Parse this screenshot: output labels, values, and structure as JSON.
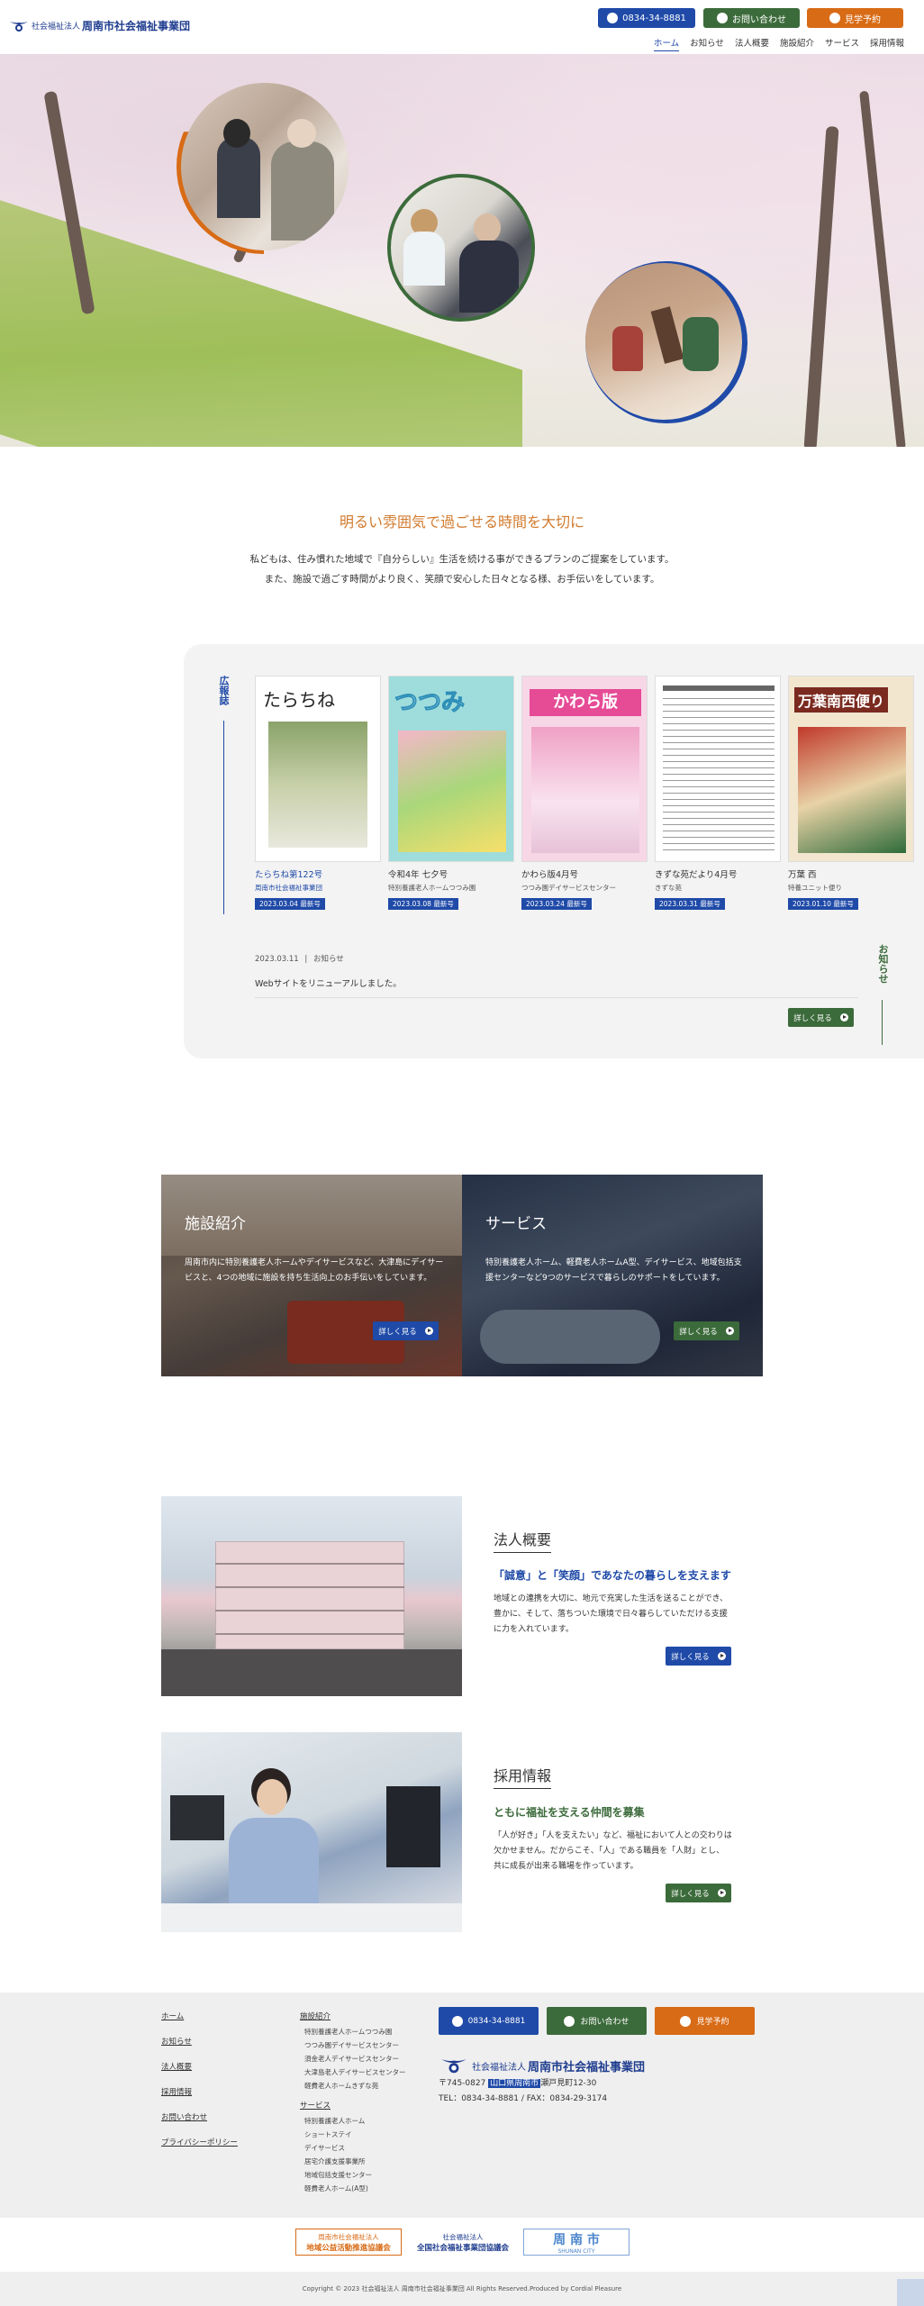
{
  "header": {
    "logo_small": "社会福祉法人",
    "logo_big": "周南市社会福祉事業団",
    "tel_label": "0834-34-8881",
    "contact_label": "お問い合わせ",
    "visit_label": "見学予約",
    "nav": [
      "ホーム",
      "お知らせ",
      "法人概要",
      "施設紹介",
      "サービス",
      "採用情報"
    ]
  },
  "intro": {
    "title": "明るい雰囲気で過ごせる時間を大切に",
    "line1": "私どもは、住み慣れた地域で『自分らしい』生活を続ける事ができるプランのご提案をしています。",
    "line2": "また、施設で過ごす時間がより良く、笑顔で安心した日々となる様、お手伝いをしています。"
  },
  "kouho": {
    "label": "広報誌",
    "items": [
      {
        "title": "たらちね第122号",
        "sub": "周南市社会福祉事業団",
        "date": "2023.03.04 最新号",
        "cover_title": "たらちね"
      },
      {
        "title": "令和4年 七夕号",
        "sub": "特別養護老人ホームつつみ園",
        "date": "2023.03.08 最新号",
        "cover_title": "つつみ"
      },
      {
        "title": "かわら版4月号",
        "sub": "つつみ園デイサービスセンター",
        "date": "2023.03.24 最新号",
        "cover_title": "かわら版"
      },
      {
        "title": "きずな苑だより4月号",
        "sub": "きずな苑",
        "date": "2023.03.31 最新号",
        "cover_title": ""
      },
      {
        "title": "万葉 西",
        "sub": "特養ユニット便り",
        "date": "2023.01.10 最新号",
        "cover_title": "万葉南西便り"
      }
    ]
  },
  "news": {
    "label": "お知らせ",
    "date": "2023.03.11",
    "category": "お知らせ",
    "title": "Webサイトをリニューアルしました。",
    "more_label": "詳しく見る"
  },
  "tiles": [
    {
      "title": "施設紹介",
      "text": "周南市内に特別養護老人ホームやデイサービスなど、大津島にデイサービスと、4つの地域に施設を持ち生活向上のお手伝いをしています。",
      "more_label": "詳しく見る"
    },
    {
      "title": "サービス",
      "text": "特別養護老人ホーム、軽費老人ホームA型、デイサービス、地域包括支援センターなど9つのサービスで暮らしのサポートをしています。",
      "more_label": "詳しく見る"
    }
  ],
  "about": {
    "title": "法人概要",
    "sub": "「誠意」と「笑顔」であなたの暮らしを支えます",
    "text": "地域との連携を大切に、地元で充実した生活を送ることができ、豊かに、そして、落ちついた環境で日々暮らしていただける支援に力を入れています。",
    "more_label": "詳しく見る"
  },
  "recruit": {
    "title": "採用情報",
    "sub": "ともに福祉を支える仲間を募集",
    "text": "「人が好き」「人を支えたい」など、福祉において人との交わりは欠かせません。だからこそ、「人」である職員を「人財」とし、共に成長が出来る職場を作っています。",
    "more_label": "詳しく見る"
  },
  "footer": {
    "col1": [
      "ホーム",
      "お知らせ",
      "法人概要",
      "採用情報",
      "お問い合わせ",
      "プライバシーポリシー"
    ],
    "facility_head": "施設紹介",
    "facilities": [
      "特別養護老人ホームつつみ園",
      "つつみ園デイサービスセンター",
      "須金老人デイサービスセンター",
      "大津島老人デイサービスセンター",
      "軽費老人ホームきずな苑"
    ],
    "service_head": "サービス",
    "services": [
      "特別養護老人ホーム",
      "ショートステイ",
      "デイサービス",
      "居宅介護支援事業所",
      "地域包括支援センター",
      "軽費老人ホーム(A型)"
    ],
    "tel_label": "0834-34-8881",
    "contact_label": "お問い合わせ",
    "visit_label": "見学予約",
    "logo_small": "社会福祉法人",
    "logo_big": "周南市社会福祉事業団",
    "address_pre": "〒745-0827 ",
    "address_highlight": "山口県周南市",
    "address_post": "瀬戸見町12-30",
    "phone_fax": "TEL：0834-34-8881 / FAX：0834-29-3174"
  },
  "banners": [
    {
      "line1": "周南市社会福祉法人",
      "line2": "地域公益活動推進協議会"
    },
    {
      "line1": "社会福祉法人",
      "line2": "全国社会福祉事業団協議会"
    },
    {
      "line1": "周 南 市",
      "line2": "SHUNAN CITY"
    }
  ],
  "copyright": "Copyright © 2023 社会福祉法人 周南市社会福祉事業団 All Rights Reserved.Produced by Cordial Pleasure",
  "colors": {
    "blue": "#1f4aa8",
    "green": "#3c6b3b",
    "orange": "#d86b16"
  }
}
